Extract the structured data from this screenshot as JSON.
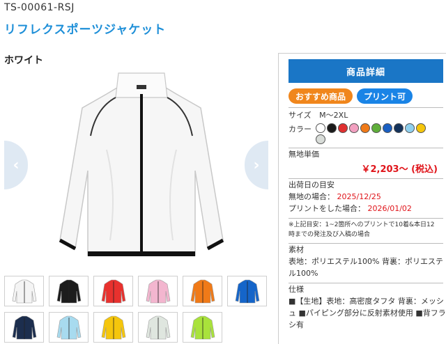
{
  "product": {
    "code": "TS-00061-RSJ",
    "title": "リフレクスポーツジャケット",
    "color_name": "ホワイト"
  },
  "nav": {
    "prev": "‹",
    "next": "›"
  },
  "thumbnails": [
    {
      "color": "#f4f4f4"
    },
    {
      "color": "#1c1c1c"
    },
    {
      "color": "#e8312e"
    },
    {
      "color": "#f3b6cf"
    },
    {
      "color": "#f07a18"
    },
    {
      "color": "#1565c9"
    },
    {
      "color": "#1c2e4e"
    },
    {
      "color": "#a8dbef"
    },
    {
      "color": "#f5c60c"
    },
    {
      "color": "#dfe6df"
    },
    {
      "color": "#a9e23b"
    }
  ],
  "panel": {
    "detail_label": "商品詳細",
    "tag_recommend": "おすすめ商品",
    "tag_print": "プリント可",
    "size_label": "サイズ",
    "size_value": "M～2XL",
    "color_label": "カラー",
    "swatches": [
      "#ffffff",
      "#1a1a1a",
      "#e03030",
      "#f2a0c0",
      "#f07a18",
      "#5fae3a",
      "#1a5fc2",
      "#14325a",
      "#8fd0ee",
      "#f5c60c",
      "#d8dcd8"
    ],
    "unit_price_label": "無地単価",
    "price": "￥2,203～ (税込)",
    "ship_label": "出荷日の目安",
    "plain_label": "無地の場合：",
    "plain_date": "2025/12/25",
    "print_label": "プリントをした場合：",
    "print_date": "2026/01/02",
    "note": "※上記目安：1~2箇所へのプリントで10着&本日12時までの発注及び入稿の場合",
    "material_label": "素材",
    "material_value": "表地：ポリエステル100% 背裏：ポリエステル100%",
    "spec_label": "仕様",
    "spec_value": "■【生地】表地：高密度タフタ 背裏：メッシュ ■パイピング部分に反射素材使用 ■背フラシ有"
  },
  "icons": {
    "main_image": "white-jacket-image",
    "thumb": "jacket-thumbnail"
  }
}
